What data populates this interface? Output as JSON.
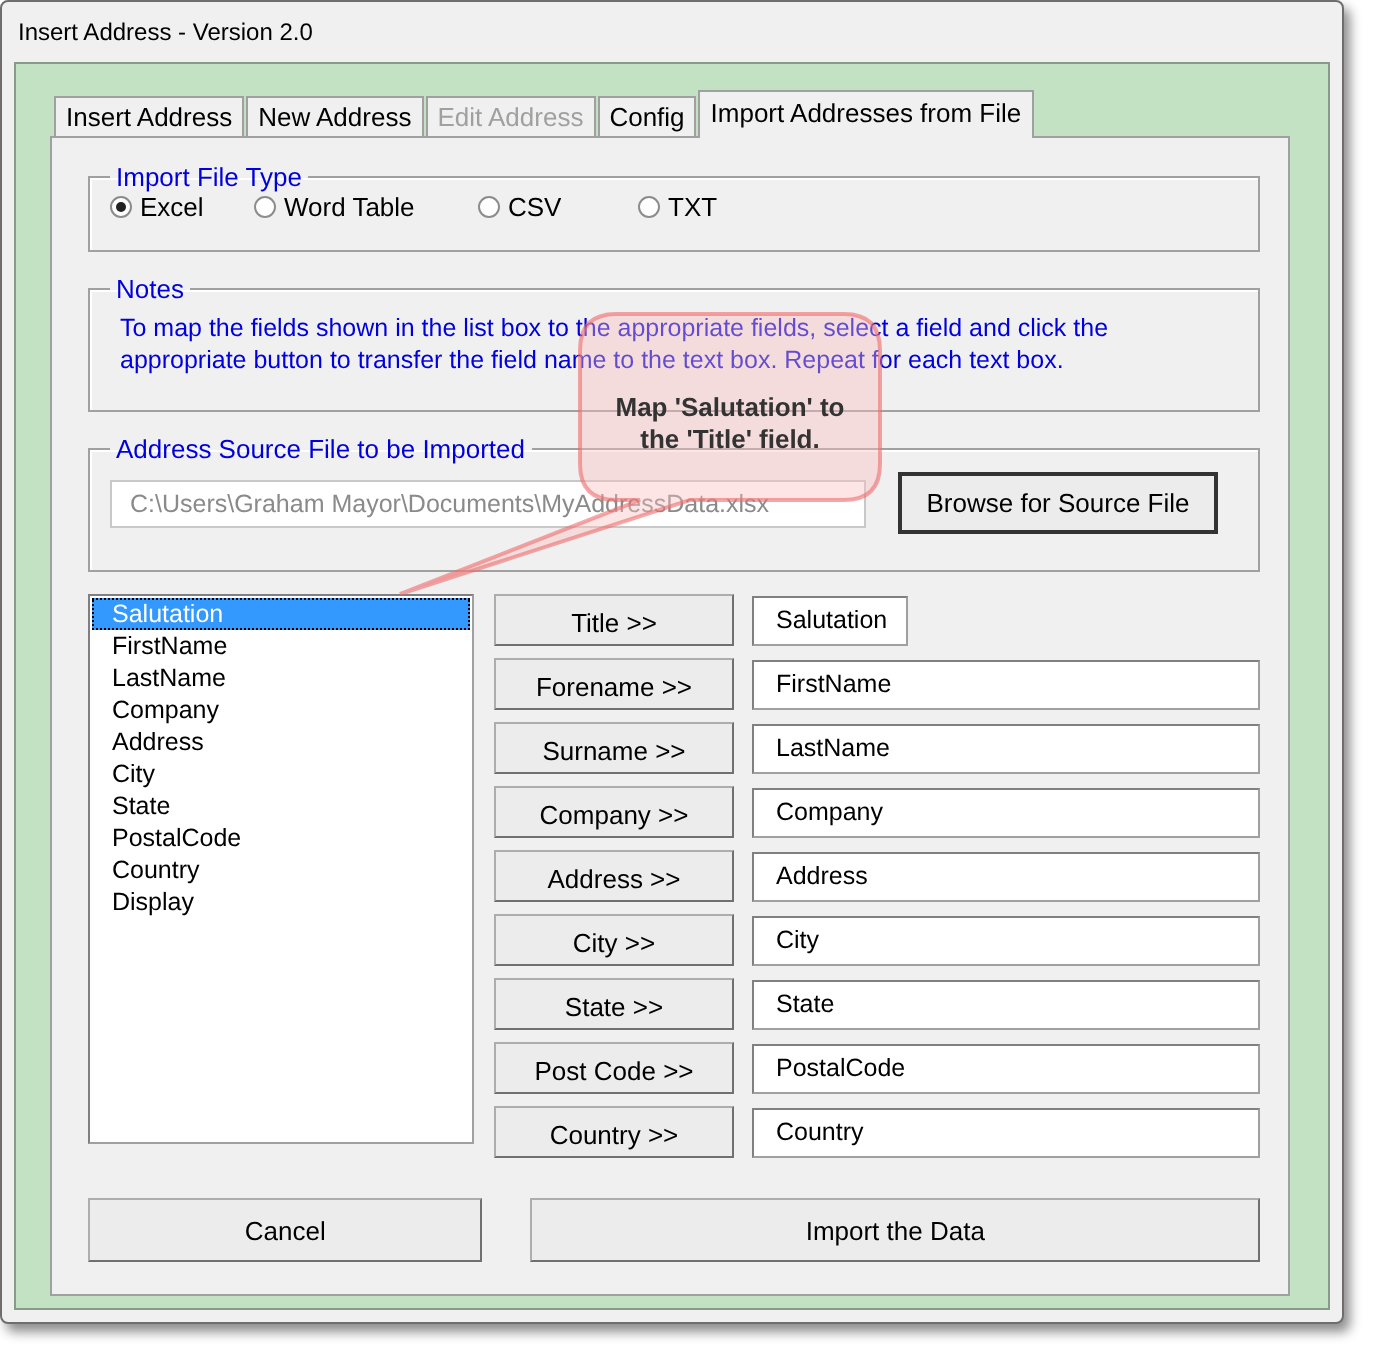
{
  "window": {
    "title": "Insert Address - Version 2.0"
  },
  "tabs": [
    {
      "label": "Insert Address",
      "selected": false,
      "disabled": false
    },
    {
      "label": "New Address",
      "selected": false,
      "disabled": false
    },
    {
      "label": "Edit Address",
      "selected": false,
      "disabled": true
    },
    {
      "label": "Config",
      "selected": false,
      "disabled": false
    },
    {
      "label": "Import Addresses from File",
      "selected": true,
      "disabled": false
    }
  ],
  "file_type": {
    "legend": "Import File Type",
    "options": [
      {
        "label": "Excel",
        "selected": true
      },
      {
        "label": "Word Table",
        "selected": false
      },
      {
        "label": "CSV",
        "selected": false
      },
      {
        "label": "TXT",
        "selected": false
      }
    ]
  },
  "notes": {
    "legend": "Notes",
    "text": "To map the fields shown in the list box to the appropriate fields, select a field and click the appropriate button to transfer the field name to the text box. Repeat for each text box."
  },
  "source": {
    "legend": "Address Source File to be Imported",
    "path": "C:\\Users\\Graham Mayor\\Documents\\MyAddressData.xlsx",
    "button": "Browse for Source File"
  },
  "field_list": [
    {
      "label": "Salutation",
      "selected": true
    },
    {
      "label": "FirstName",
      "selected": false
    },
    {
      "label": "LastName",
      "selected": false
    },
    {
      "label": "Company",
      "selected": false
    },
    {
      "label": "Address",
      "selected": false
    },
    {
      "label": "City",
      "selected": false
    },
    {
      "label": "State",
      "selected": false
    },
    {
      "label": "PostalCode",
      "selected": false
    },
    {
      "label": "Country",
      "selected": false
    },
    {
      "label": "Display",
      "selected": false
    }
  ],
  "mappings": [
    {
      "button": "Title >>",
      "value": "Salutation",
      "wide": false
    },
    {
      "button": "Forename >>",
      "value": "FirstName",
      "wide": true
    },
    {
      "button": "Surname >>",
      "value": "LastName",
      "wide": true
    },
    {
      "button": "Company >>",
      "value": "Company",
      "wide": true
    },
    {
      "button": "Address >>",
      "value": "Address",
      "wide": true
    },
    {
      "button": "City >>",
      "value": "City",
      "wide": true
    },
    {
      "button": "State >>",
      "value": "State",
      "wide": true
    },
    {
      "button": "Post Code >>",
      "value": "PostalCode",
      "wide": true
    },
    {
      "button": "Country >>",
      "value": "Country",
      "wide": true
    }
  ],
  "buttons": [
    "Cancel",
    "Import the Data"
  ],
  "callout": {
    "text": "Map 'Salutation' to the 'Title' field."
  }
}
